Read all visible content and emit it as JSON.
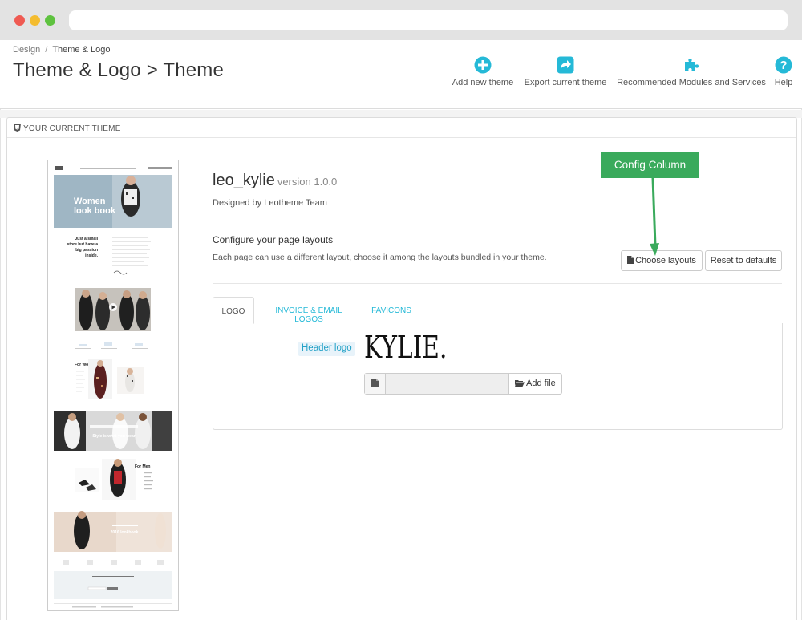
{
  "breadcrumb": {
    "parent": "Design",
    "separator": "/",
    "current": "Theme & Logo"
  },
  "page": {
    "title": "Theme & Logo > Theme"
  },
  "toolbar": {
    "items": [
      {
        "label": "Add new theme",
        "icon": "plus-circle-icon"
      },
      {
        "label": "Export current theme",
        "icon": "share-icon"
      },
      {
        "label": "Recommended Modules and Services",
        "icon": "puzzle-icon"
      },
      {
        "label": "Help",
        "icon": "help-icon"
      }
    ]
  },
  "panel": {
    "heading": "YOUR CURRENT THEME",
    "icon": "html5-shield-icon"
  },
  "theme": {
    "name": "leo_kylie",
    "version": "version 1.0.0",
    "designed_by": "Designed by Leotheme Team",
    "preview": {
      "hero_title_1": "Women",
      "hero_title_2": "look book",
      "tagline": "Just a small store but have a big passion inside.",
      "for_women": "For Women",
      "for_men": "For Men",
      "banner_text": "Style is what you wear",
      "lookbook": "2016 lookbook"
    }
  },
  "layouts": {
    "title": "Configure your page layouts",
    "description": "Each page can use a different layout, choose it among the layouts bundled in your theme.",
    "choose_label": "Choose layouts",
    "reset_label": "Reset to defaults"
  },
  "callout": {
    "label": "Config Column",
    "color": "#3aaa5c"
  },
  "tabs": [
    {
      "label": "LOGO",
      "active": true
    },
    {
      "label": "INVOICE & EMAIL LOGOS",
      "active": false
    },
    {
      "label": "FAVICONS",
      "active": false
    }
  ],
  "logo_tab": {
    "header_logo_label": "Header logo",
    "logo_text": "KYLIE.",
    "file_value": "",
    "add_file_label": "Add file"
  },
  "colors": {
    "accent": "#25b9d7",
    "text": "#333333",
    "callout": "#3aaa5c"
  }
}
